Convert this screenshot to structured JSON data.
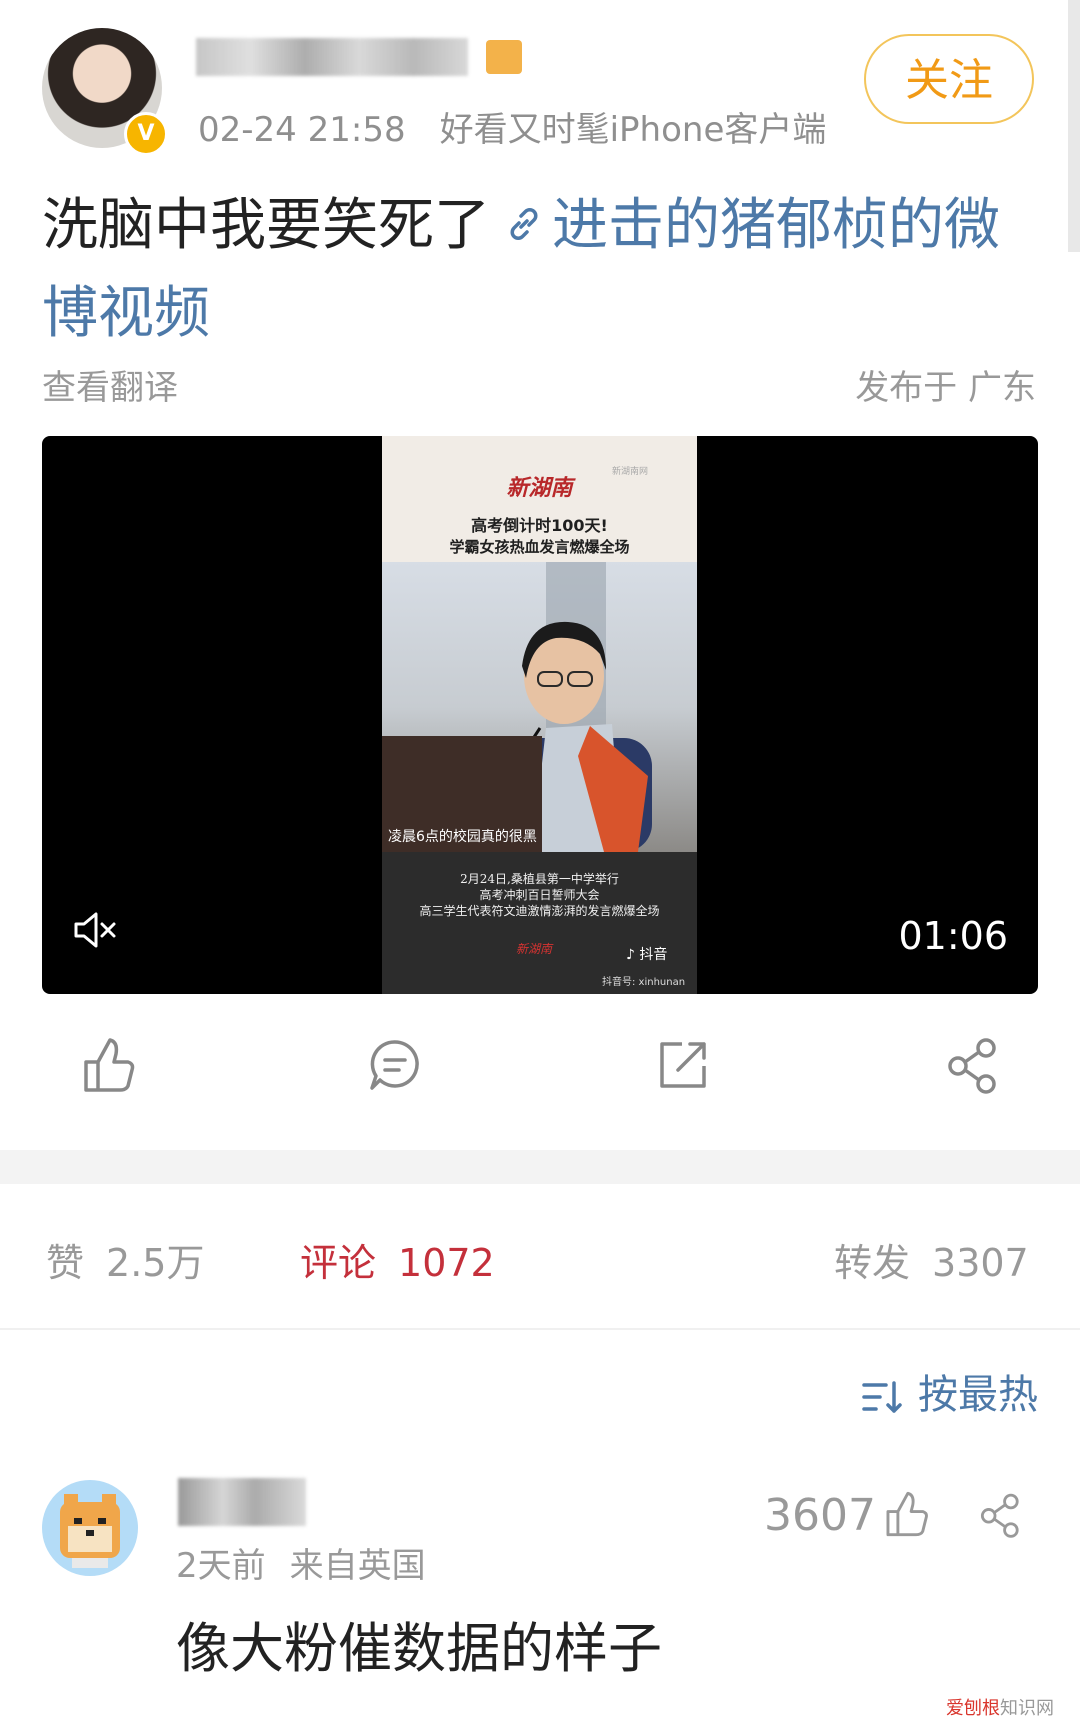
{
  "post": {
    "timestamp": "02-24 21:58",
    "source": "好看又时髦iPhone客户端",
    "follow_label": "关注",
    "text": "洗脑中我要笑死了",
    "link_text": "进击的猪郁桢的微博视频",
    "translate_label": "查看翻译",
    "location": "发布于 广东",
    "verified_badge": "V"
  },
  "video": {
    "duration": "01:06",
    "brand": "新湖南",
    "watermark": "新湖南网",
    "headline_1": "高考倒计时100天!",
    "headline_2": "学霸女孩热血发言燃爆全场",
    "subtitle": "凌晨6点的校园真的很黑",
    "caption_1": "2月24日,桑植县第一中学举行",
    "caption_2": "高考冲刺百日誓师大会",
    "caption_3": "高三学生代表符文迪激情澎湃的发言燃爆全场",
    "bottom_logo": "新湖南",
    "douyin_label": "抖音",
    "douyin_id": "抖音号: xinhunan"
  },
  "stats": {
    "likes_label": "赞",
    "likes_value": "2.5万",
    "comments_label": "评论",
    "comments_value": "1072",
    "reposts_label": "转发",
    "reposts_value": "3307"
  },
  "sort": {
    "label": "按最热"
  },
  "comment": {
    "time": "2天前",
    "from": "来自英国",
    "likes": "3607",
    "text": "像大粉催数据的样子"
  },
  "site_watermark": {
    "part1": "爱刨根",
    "part2": "知识网"
  },
  "colors": {
    "link": "#4d79a8",
    "follow_text": "#f19a16",
    "follow_border": "#f3c55b",
    "active_tab": "#c4303b",
    "muted_text": "#999999"
  },
  "icons": [
    "link-icon",
    "mute-icon",
    "like-icon",
    "comment-icon",
    "repost-icon",
    "share-icon",
    "sort-icon"
  ]
}
